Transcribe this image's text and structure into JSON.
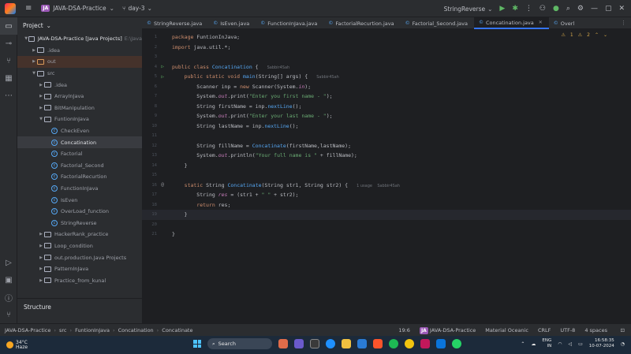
{
  "titlebar": {
    "project_badge": "JA",
    "project_name": "JAVA-DSA-Practice",
    "branch": "day-3",
    "run_config": "StringReverse"
  },
  "project_panel": {
    "title": "Project",
    "tree": [
      {
        "label": "JAVA-DSA-Practice [Java Projects]",
        "suffix": "E:\\Java",
        "depth": 0,
        "kind": "folder",
        "open": true
      },
      {
        "label": ".idea",
        "depth": 1,
        "kind": "folder"
      },
      {
        "label": "out",
        "depth": 1,
        "kind": "folder-orange",
        "hl": true
      },
      {
        "label": "src",
        "depth": 1,
        "kind": "folder",
        "open": true
      },
      {
        "label": ".idea",
        "depth": 2,
        "kind": "folder"
      },
      {
        "label": "ArrayInJava",
        "depth": 2,
        "kind": "folder"
      },
      {
        "label": "BitManipulation",
        "depth": 2,
        "kind": "folder"
      },
      {
        "label": "FuntionInJava",
        "depth": 2,
        "kind": "folder",
        "open": true
      },
      {
        "label": "CheckEven",
        "depth": 3,
        "kind": "class"
      },
      {
        "label": "Concatination",
        "depth": 3,
        "kind": "class",
        "sel": true
      },
      {
        "label": "Factorial",
        "depth": 3,
        "kind": "class"
      },
      {
        "label": "Factorial_Second",
        "depth": 3,
        "kind": "class"
      },
      {
        "label": "FactorialRecurtion",
        "depth": 3,
        "kind": "class"
      },
      {
        "label": "FunctionInJava",
        "depth": 3,
        "kind": "class"
      },
      {
        "label": "IsEven",
        "depth": 3,
        "kind": "class"
      },
      {
        "label": "OverLoad_function",
        "depth": 3,
        "kind": "class"
      },
      {
        "label": "StringReverse",
        "depth": 3,
        "kind": "class"
      },
      {
        "label": "HackerRank_practice",
        "depth": 2,
        "kind": "folder"
      },
      {
        "label": "Loop_condition",
        "depth": 2,
        "kind": "folder"
      },
      {
        "label": "out.production.Java Projects",
        "depth": 2,
        "kind": "folder"
      },
      {
        "label": "PatternInJava",
        "depth": 2,
        "kind": "folder"
      },
      {
        "label": "Practice_from_kunal",
        "depth": 2,
        "kind": "folder"
      }
    ],
    "structure_title": "Structure"
  },
  "tabs": [
    {
      "label": "StringReverse.java"
    },
    {
      "label": "IsEven.java"
    },
    {
      "label": "FunctionInJava.java"
    },
    {
      "label": "FactorialRecurtion.java"
    },
    {
      "label": "Factorial_Second.java"
    },
    {
      "label": "Concatination.java",
      "active": true
    },
    {
      "label": "Overl"
    }
  ],
  "inspections": {
    "warnings": "1",
    "weak_warnings": "2"
  },
  "editor": {
    "lines": [
      {
        "n": "1",
        "tokens": [
          [
            "kw",
            "package "
          ],
          [
            "",
            "FuntionInJava;"
          ]
        ]
      },
      {
        "n": "2",
        "tokens": [
          [
            "kw",
            "import "
          ],
          [
            "",
            "java.util.*;"
          ]
        ]
      },
      {
        "n": "3",
        "tokens": []
      },
      {
        "n": "4",
        "run": true,
        "tokens": [
          [
            "kw",
            "public class "
          ],
          [
            "fn",
            "Concatination"
          ],
          [
            "",
            " {  "
          ],
          [
            "hint",
            "  Sabbir4Sah"
          ]
        ]
      },
      {
        "n": "5",
        "run": true,
        "tokens": [
          [
            "",
            "    "
          ],
          [
            "kw",
            "public static void "
          ],
          [
            "fn",
            "main"
          ],
          [
            "",
            "(String[] args) {  "
          ],
          [
            "hint",
            "  Sabbir4Sah"
          ]
        ]
      },
      {
        "n": "6",
        "tokens": [
          [
            "",
            "        Scanner inp = "
          ],
          [
            "kw",
            "new "
          ],
          [
            "",
            "Scanner(System."
          ],
          [
            "fld",
            "in"
          ],
          [
            "",
            ");"
          ]
        ]
      },
      {
        "n": "7",
        "tokens": [
          [
            "",
            "        System."
          ],
          [
            "fld",
            "out"
          ],
          [
            "",
            ".print("
          ],
          [
            "str",
            "\"Enter you first name - \""
          ],
          [
            "",
            ");"
          ]
        ]
      },
      {
        "n": "8",
        "tokens": [
          [
            "",
            "        String firstName = inp."
          ],
          [
            "fn",
            "nextLine"
          ],
          [
            "",
            "();"
          ]
        ]
      },
      {
        "n": "9",
        "tokens": [
          [
            "",
            "        System."
          ],
          [
            "fld",
            "out"
          ],
          [
            "",
            ".print("
          ],
          [
            "str",
            "\"Enter your last name - \""
          ],
          [
            "",
            ");"
          ]
        ]
      },
      {
        "n": "10",
        "tokens": [
          [
            "",
            "        String lastName = inp."
          ],
          [
            "fn",
            "nextLine"
          ],
          [
            "",
            "();"
          ]
        ]
      },
      {
        "n": "11",
        "tokens": []
      },
      {
        "n": "12",
        "tokens": [
          [
            "",
            "        String fillName = "
          ],
          [
            "fn",
            "Concatinate"
          ],
          [
            "",
            "(firstName,lastName);"
          ]
        ]
      },
      {
        "n": "13",
        "tokens": [
          [
            "",
            "        System."
          ],
          [
            "fld",
            "out"
          ],
          [
            "",
            ".println("
          ],
          [
            "str",
            "\"Your full name is \""
          ],
          [
            "",
            " + fillName);"
          ]
        ]
      },
      {
        "n": "14",
        "tokens": [
          [
            "",
            "    }"
          ]
        ]
      },
      {
        "n": "15",
        "tokens": []
      },
      {
        "n": "16",
        "at": true,
        "tokens": [
          [
            "",
            "    "
          ],
          [
            "kw",
            "static "
          ],
          [
            "",
            "String "
          ],
          [
            "fn",
            "Concatinate"
          ],
          [
            "",
            "(String str1, String str2) {  "
          ],
          [
            "hint",
            "  1 usage    Sabbir4Sah"
          ]
        ]
      },
      {
        "n": "17",
        "tokens": [
          [
            "",
            "        String "
          ],
          [
            "fld",
            "res"
          ],
          [
            "",
            " = (str1 + "
          ],
          [
            "str",
            "\" \""
          ],
          [
            "",
            " + str2);"
          ]
        ]
      },
      {
        "n": "18",
        "tokens": [
          [
            "",
            "        "
          ],
          [
            "kw",
            "return "
          ],
          [
            "",
            "res;"
          ]
        ]
      },
      {
        "n": "19",
        "cur": true,
        "tokens": [
          [
            "",
            "    }"
          ]
        ]
      },
      {
        "n": "20",
        "tokens": []
      },
      {
        "n": "21",
        "tokens": [
          [
            "",
            "}"
          ]
        ]
      }
    ]
  },
  "statusbar": {
    "crumbs": [
      "JAVA-DSA-Practice",
      "src",
      "FuntionInJava",
      "Concatination",
      "Concatinate"
    ],
    "position": "19:6",
    "project_badge": "JA",
    "project": "JAVA-DSA-Practice",
    "theme": "Material Oceanic",
    "line_sep": "CRLF",
    "encoding": "UTF-8",
    "indent": "4 spaces"
  },
  "taskbar": {
    "temp": "34°C",
    "weather": "Haze",
    "search_placeholder": "Search",
    "lang1": "ENG",
    "lang2": "IN",
    "time": "16:58:35",
    "date": "10-07-2024"
  }
}
